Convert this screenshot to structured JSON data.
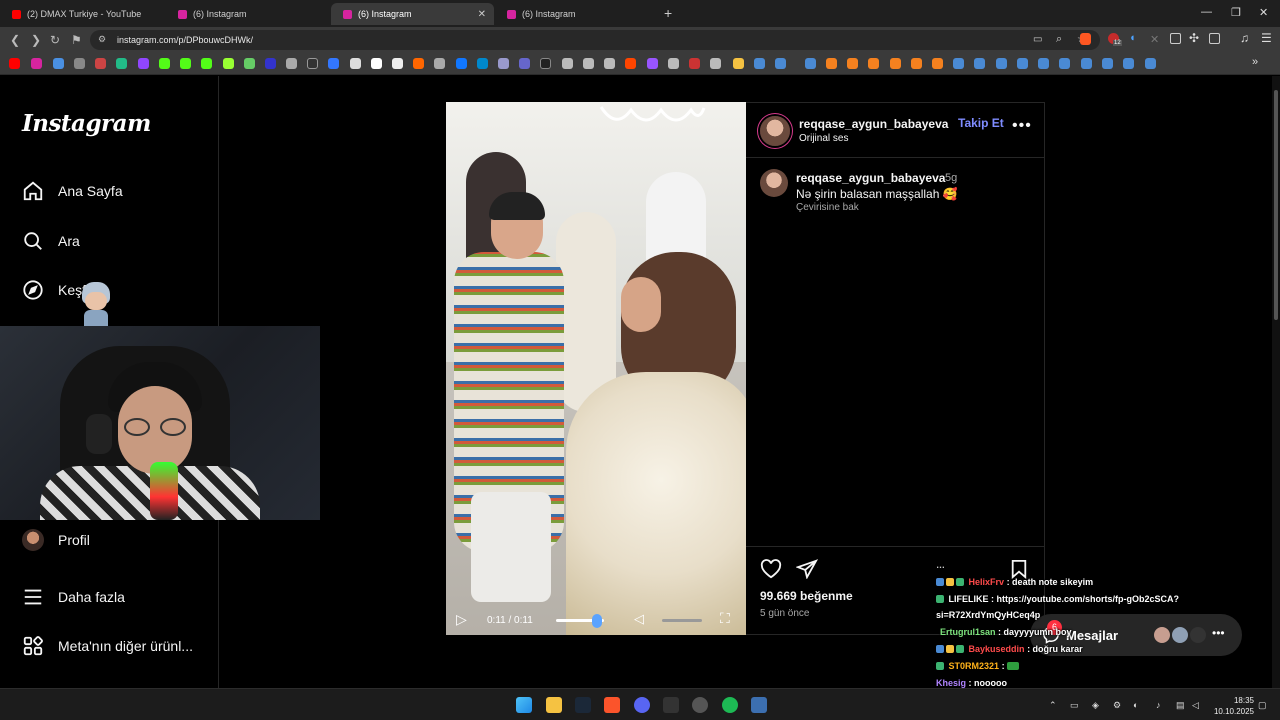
{
  "browser": {
    "tabs": [
      {
        "label": "(2) DMAX Turkiye - YouTube",
        "favicon_color": "#ff0000",
        "active": false
      },
      {
        "label": "(6) Instagram",
        "favicon_color": "#d6249f",
        "active": false
      },
      {
        "label": "(6) Instagram",
        "favicon_color": "#d6249f",
        "active": true
      },
      {
        "label": "(6) Instagram",
        "favicon_color": "#d6249f",
        "active": false
      }
    ],
    "url": "instagram.com/p/DPbouwcDHWk/",
    "extension_badge": "12"
  },
  "nav": {
    "logo": "Instagram",
    "items": [
      {
        "label": "Ana Sayfa",
        "icon": "home-icon"
      },
      {
        "label": "Ara",
        "icon": "search-icon"
      },
      {
        "label": "Keşfet",
        "icon": "compass-icon"
      },
      {
        "label": "Profil",
        "icon": "avatar"
      },
      {
        "label": "Daha fazla",
        "icon": "menu-icon"
      },
      {
        "label": "Meta'nın diğer ürünl...",
        "icon": "grid-icon"
      }
    ]
  },
  "post": {
    "username": "reqqase_aygun_babayeva",
    "follow_label": "Takip Et",
    "audio": "Orijinal ses",
    "comment_user": "reqqase_aygun_babayeva",
    "comment_age": "5g",
    "caption": "Nə şirin balasan maşşallah 🥰",
    "see_translation": "Çevirisine bak",
    "likes": "99.669 beğenme",
    "posted": "5 gün önce",
    "video_time": "0:11 / 0:11",
    "progress_fraction": 1.0
  },
  "messages": {
    "label": "Mesajlar",
    "badge": "6"
  },
  "chat": [
    {
      "user": "",
      "text": "…",
      "user_color": "#ffffff"
    },
    {
      "user": "HelixFrv",
      "text": ": death note sikeyim",
      "user_color": "#ff4b4b"
    },
    {
      "user": "LIFELIKE",
      "text": ": https://youtube.com/shorts/fp-gOb2cSCA?",
      "user_color": "#ffffff"
    },
    {
      "user": "",
      "text": "si=R72XrdYmQyHCeq4p",
      "user_color": "#ffffff"
    },
    {
      "user": "Ertugrul1san",
      "text": ": dayyyyumn boy",
      "user_color": "#7ee37e"
    },
    {
      "user": "Baykuseddin",
      "text": ": doğru karar",
      "user_color": "#ff4b4b"
    },
    {
      "user": "ST0RM2321",
      "text": ":",
      "user_color": "#ffb31a"
    },
    {
      "user": "Khesig",
      "text": ": nooooo",
      "user_color": "#b084ff"
    }
  ],
  "taskbar": {
    "time": "18:35",
    "date": "10.10.2025"
  }
}
